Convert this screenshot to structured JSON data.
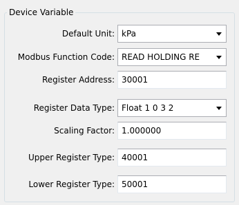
{
  "group": {
    "title": "Device Variable"
  },
  "fields": {
    "default_unit": {
      "label": "Default Unit:",
      "value": "kPa"
    },
    "modbus_function_code": {
      "label": "Modbus Function Code:",
      "value": "READ HOLDING RE"
    },
    "register_address": {
      "label": "Register Address:",
      "value": "30001"
    },
    "register_data_type": {
      "label": "Register Data Type:",
      "value": "Float 1 0 3 2"
    },
    "scaling_factor": {
      "label": "Scaling Factor:",
      "value": "1.000000"
    },
    "upper_register_type": {
      "label": "Upper Register Type:",
      "value": "40001"
    },
    "lower_register_type": {
      "label": "Lower Register Type:",
      "value": "50001"
    }
  },
  "icons": {
    "dropdown": "chevron-down-icon"
  }
}
